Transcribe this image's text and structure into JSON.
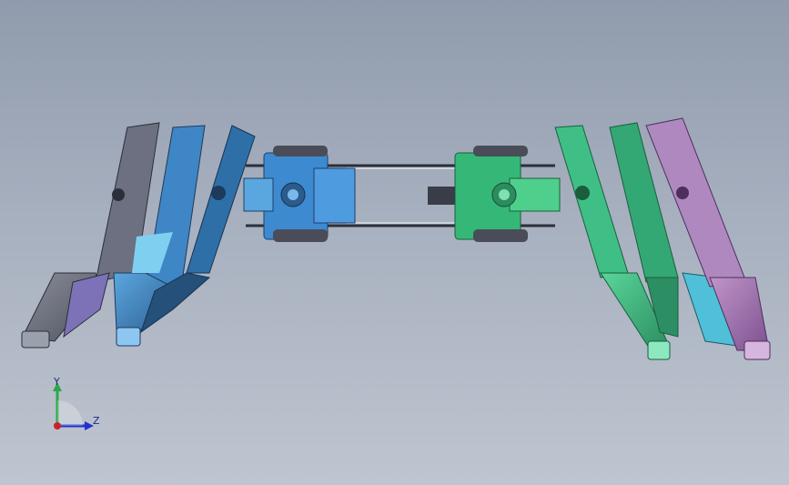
{
  "viewport": {
    "background_top": "#909bad",
    "background_bottom": "#bfc5d0"
  },
  "model": {
    "colors": {
      "gray": "#6f7280",
      "purple": "#7d72b8",
      "blue_light": "#4a8ec8",
      "blue_dark": "#2e5f8f",
      "cyan": "#4fc0d8",
      "green": "#3fbf86",
      "green_dark": "#2c8f63",
      "violet": "#a77ab3",
      "frame": "#2b2f3a"
    }
  },
  "triad": {
    "y_label": "Y",
    "z_label": "Z",
    "y_color": "#2aa84a",
    "z_color": "#2233cc",
    "x_color": "#cc2222"
  }
}
